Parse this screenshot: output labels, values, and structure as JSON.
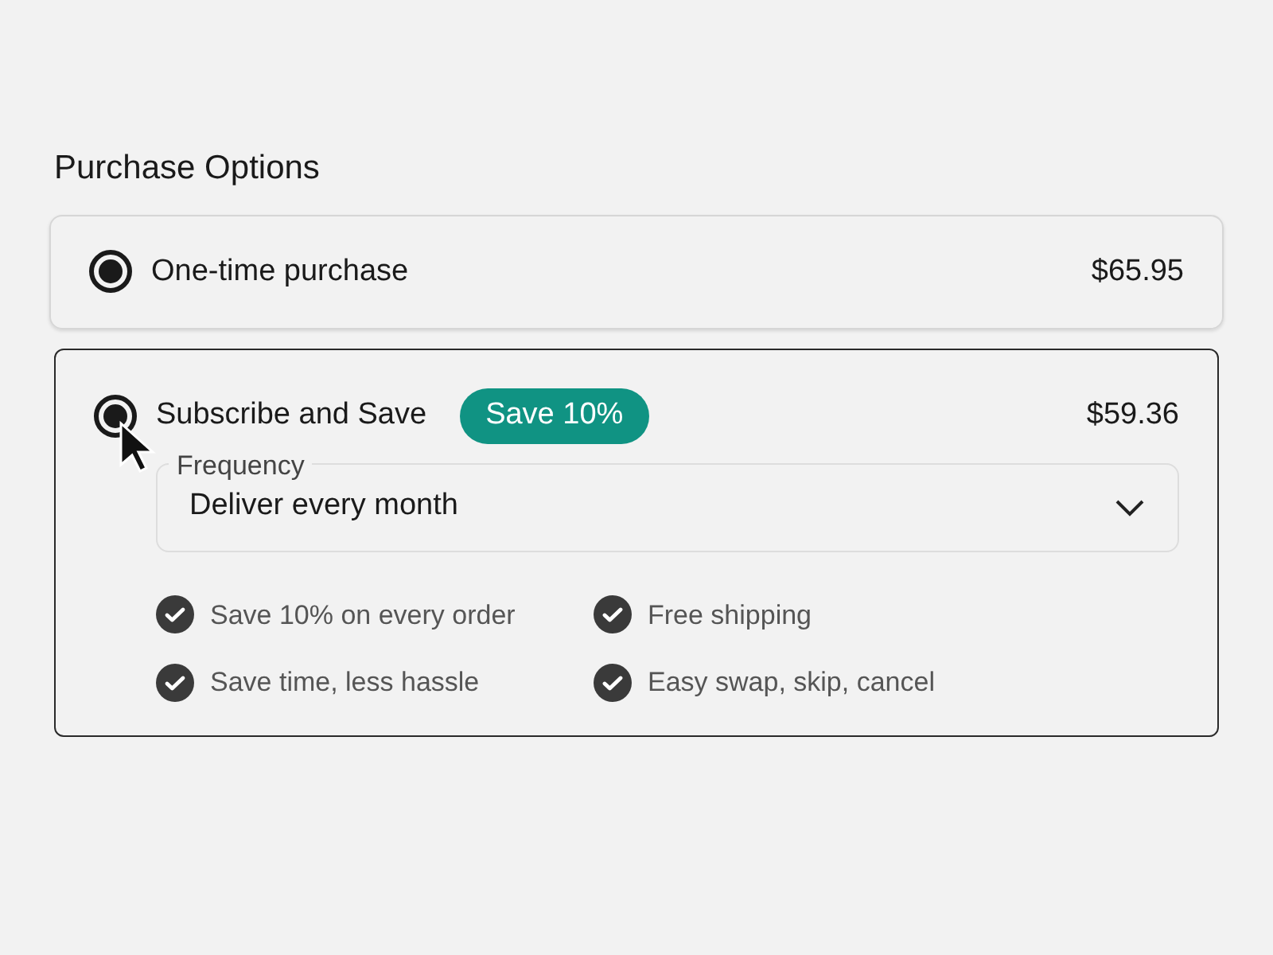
{
  "heading": "Purchase Options",
  "options": [
    {
      "label": "One-time purchase",
      "price": "$65.95",
      "selected": false,
      "checked": true
    },
    {
      "label": "Subscribe and Save",
      "badge": "Save 10%",
      "price": "$59.36",
      "selected": true,
      "checked": true,
      "frequency": {
        "label": "Frequency",
        "value": "Deliver every month"
      },
      "benefits": [
        "Save 10% on every order",
        "Free shipping",
        "Save time, less hassle",
        "Easy swap, skip, cancel"
      ]
    }
  ]
}
